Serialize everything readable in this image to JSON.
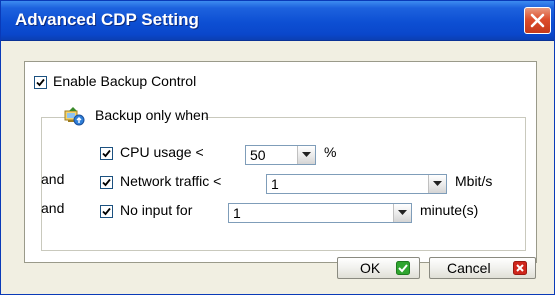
{
  "window": {
    "title": "Advanced CDP Setting"
  },
  "enable_backup": {
    "label": "Enable Backup Control",
    "checked": true
  },
  "group": {
    "legend": "Backup only when"
  },
  "conditions": {
    "and1": "and",
    "and2": "and",
    "cpu": {
      "label": "CPU usage <",
      "value": "50",
      "unit": "%",
      "checked": true
    },
    "network": {
      "label": "Network traffic <",
      "value": "1",
      "unit": "Mbit/s",
      "checked": true
    },
    "input": {
      "label": "No input for",
      "value": "1",
      "unit": "minute(s)",
      "checked": true
    }
  },
  "buttons": {
    "ok": "OK",
    "cancel": "Cancel"
  },
  "colors": {
    "titlebar": "#0a47cb",
    "check_green": "#2fa52f",
    "cancel_red": "#d0261c"
  },
  "icons": {
    "close": "close-icon",
    "group": "backup-computer-icon",
    "ok": "ok-check-icon",
    "cancel": "cancel-x-icon"
  }
}
